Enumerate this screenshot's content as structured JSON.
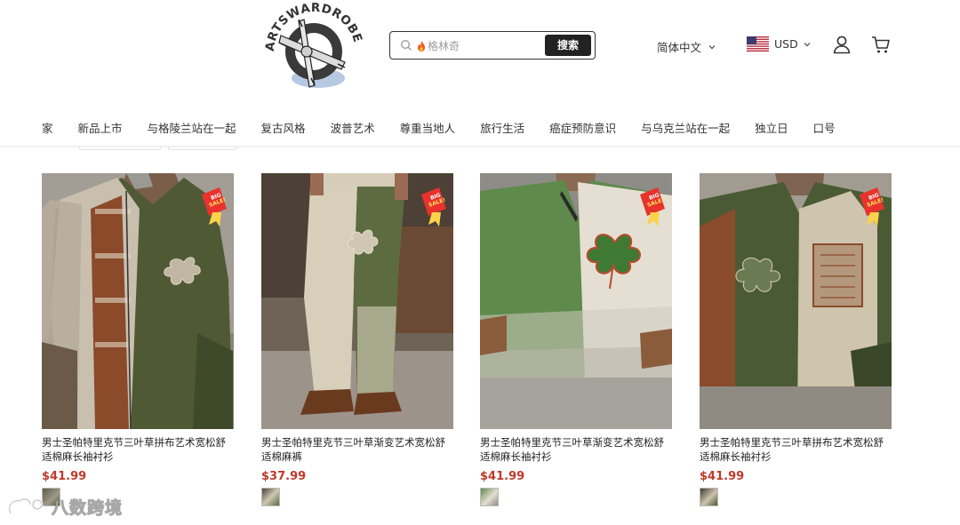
{
  "header": {
    "logo_text": "ARTSWARDROBE",
    "search": {
      "placeholder": "格林奇",
      "button_label": "搜索"
    },
    "language": {
      "label": "简体中文"
    },
    "currency": {
      "label": "USD"
    }
  },
  "nav": {
    "items": [
      {
        "label": "家"
      },
      {
        "label": "新品上市"
      },
      {
        "label": "与格陵兰站在一起"
      },
      {
        "label": "复古风格"
      },
      {
        "label": "波普艺术"
      },
      {
        "label": "尊重当地人"
      },
      {
        "label": "旅行生活"
      },
      {
        "label": "癌症预防意识"
      },
      {
        "label": "与乌克兰站在一起"
      },
      {
        "label": "独立日"
      },
      {
        "label": "口号"
      }
    ]
  },
  "badge_text": [
    "BIG",
    "SALE!"
  ],
  "products": [
    {
      "title": "男士圣帕特里克节三叶草拼布艺术宽松舒适棉麻长袖衬衫",
      "price": "$41.99"
    },
    {
      "title": "男士圣帕特里克节三叶草渐变艺术宽松舒适棉麻裤",
      "price": "$37.99"
    },
    {
      "title": "男士圣帕特里克节三叶草渐变艺术宽松舒适棉麻长袖衬衫",
      "price": "$41.99"
    },
    {
      "title": "男士圣帕特里克节三叶草拼布艺术宽松舒适棉麻长袖衬衫",
      "price": "$41.99"
    }
  ],
  "watermark": {
    "text": "八数跨境"
  },
  "colors": {
    "price": "#c0392b",
    "search_button": "#222222",
    "accent_green": "#4e7a3e"
  },
  "icons": [
    "search-icon",
    "flame-icon",
    "chevron-down-icon",
    "us-flag-icon",
    "user-icon",
    "cart-icon",
    "sale-badge-icon"
  ]
}
